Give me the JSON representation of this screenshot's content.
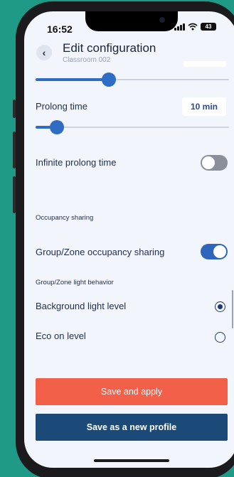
{
  "status_bar": {
    "time": "16:52",
    "battery": "43",
    "icons": [
      "cellular-signal-icon",
      "wifi-icon",
      "battery-icon"
    ]
  },
  "header": {
    "title": "Edit configuration",
    "subtitle": "Classroom 002",
    "back_icon": "chevron-left-icon"
  },
  "settings": {
    "top_slider_level": 0.38,
    "prolong_time": {
      "label": "Prolong time",
      "value": "10 min",
      "slider_level": 0.1
    },
    "infinite_prolong": {
      "label": "Infinite prolong time",
      "enabled": false
    },
    "occupancy_section_title": "Occupancy sharing",
    "group_zone_sharing": {
      "label": "Group/Zone occupancy sharing",
      "enabled": true
    },
    "light_behavior_title": "Group/Zone light behavior",
    "options": [
      {
        "label": "Background light level",
        "selected": true
      },
      {
        "label": "Eco on level",
        "selected": false
      }
    ]
  },
  "actions": {
    "save_apply": "Save and apply",
    "save_profile": "Save as a new profile"
  },
  "colors": {
    "background": "#1f9a86",
    "accent": "#2f6cc4",
    "apply_button": "#f2604a",
    "profile_button": "#1b4a78",
    "screen": "#f2f5fb"
  }
}
